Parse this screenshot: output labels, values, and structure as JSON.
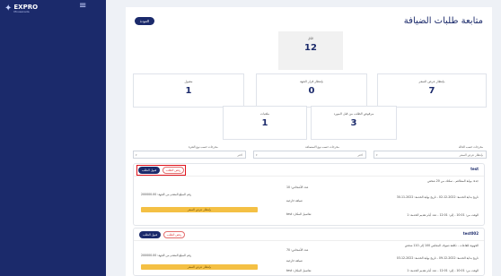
{
  "app": {
    "logo_text": "EXPRO",
    "logo_sub": "Mousanada"
  },
  "header": {
    "title": "متابعة طلبات الضيافة",
    "back_label": "العودة"
  },
  "stats": {
    "total": {
      "label": "الكل",
      "value": "12"
    },
    "row2": [
      {
        "label": "بإنتظار عرض السعر",
        "value": "7"
      },
      {
        "label": "بإنتظار قرار الجهة",
        "value": "0"
      },
      {
        "label": "مقبول",
        "value": "1"
      }
    ],
    "row3": [
      {
        "label": "مرفوض الطلب من قبل المورد",
        "value": "3"
      },
      {
        "label": "ملغيات",
        "value": "1"
      }
    ]
  },
  "filters": [
    {
      "label": "مخرجات حسب الحالة",
      "value": "بإنتظار عرض السعر"
    },
    {
      "label": "مخرجات حسب نوع الاستضافة",
      "value": "اختر"
    },
    {
      "label": "مخرجات حسب نوع الفترة",
      "value": "اختر"
    }
  ],
  "requests": [
    {
      "name": "test",
      "reject_label": "رفض الطلب",
      "accept_label": "قبول الطلب",
      "line1": "جدة: بوابة المطاعم - تمكنك من 20 شخص",
      "line2": "تاريخ بداية الخدمة: 2022-12-02 - تاريخ نهاية الخدمة: 2022-11-30",
      "line3": "الوقت من: 10:01 - إلى: 12:01 - عدد أيام تقديم الخدمة: 1",
      "people": "عدد الأشخاص: 10",
      "kind": "ضيافة خارجية",
      "location": "تفاصيل المكان: test",
      "budget": "رقم المبلغ المقدم من الجهة: 200000.00",
      "status": "بإنتظار عرض السعر"
    },
    {
      "name": "test002",
      "reject_label": "رفض الطلب",
      "accept_label": "قبول الطلب",
      "line1": "الجهوية للقاعات - تكلفة ضيوف المجلس 100 إلى 110 شخص",
      "line2": "تاريخ بداية الخدمة: 2022-12-09 - تاريخ نهاية الخدمة: 2022-12-03",
      "line3": "الوقت من: 10:01 - إلى: 12:01 - عدد أيام تقديم الخدمة: 1",
      "people": "عدد الأشخاص: 70",
      "kind": "ضيافة خارجية",
      "location": "تفاصيل المكان: test",
      "budget": "رقم المبلغ المقدم من الجهة: 200000.00",
      "status": "بإنتظار عرض السعر"
    }
  ]
}
